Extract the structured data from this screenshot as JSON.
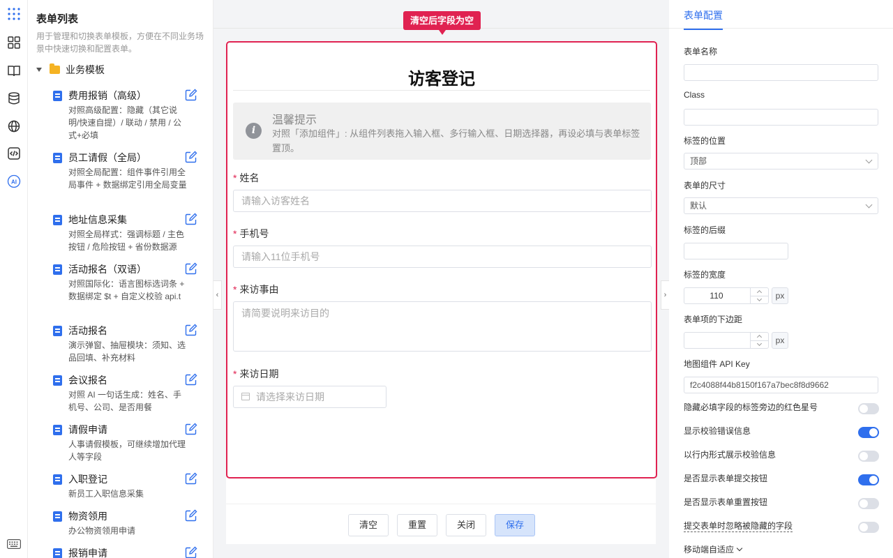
{
  "sidebar_list": {
    "title": "表单列表",
    "description": "用于管理和切换表单模板，方便在不同业务场景中快速切换和配置表单。",
    "group": "业务模板",
    "items": [
      {
        "name": "费用报销（高级）",
        "desc": "对照高级配置：隐藏（其它说明/快速自提）/ 联动 / 禁用 / 公式+必填"
      },
      {
        "name": "员工请假（全局）",
        "desc": "对照全局配置：组件事件引用全局事件 + 数据绑定引用全局变量"
      },
      {
        "name": "地址信息采集",
        "desc": "对照全局样式：强调标题 / 主色按钮 / 危险按钮 + 省份数据源"
      },
      {
        "name": "活动报名（双语）",
        "desc": "对照国际化：语言图标选词条 + 数据绑定 $t + 自定义校验 api.t"
      },
      {
        "name": "活动报名",
        "desc": "演示弹窗、抽屉模块：须知、选品回填、补充材料"
      },
      {
        "name": "会议报名",
        "desc": "对照 AI 一句话生成：姓名、手机号、公司、是否用餐"
      },
      {
        "name": "请假申请",
        "desc": "人事请假模板，可继续增加代理人等字段"
      },
      {
        "name": "入职登记",
        "desc": "新员工入职信息采集"
      },
      {
        "name": "物资领用",
        "desc": "办公物资领用申请"
      },
      {
        "name": "报销申请",
        "desc": ""
      }
    ]
  },
  "canvas": {
    "tooltip": "清空后字段为空",
    "form_title": "访客登记",
    "notice": {
      "title": "温馨提示",
      "body": "对照「添加组件」: 从组件列表拖入输入框、多行输入框、日期选择器，再设必填与表单标签置顶。"
    },
    "fields": [
      {
        "label": "姓名",
        "placeholder": "请输入访客姓名"
      },
      {
        "label": "手机号",
        "placeholder": "请输入11位手机号"
      },
      {
        "label": "来访事由",
        "placeholder": "请简要说明来访目的"
      },
      {
        "label": "来访日期",
        "placeholder": "请选择来访日期"
      }
    ],
    "buttons": {
      "clear": "清空",
      "reset": "重置",
      "close": "关闭",
      "save": "保存"
    }
  },
  "panel": {
    "tab": "表单配置",
    "form_name_label": "表单名称",
    "form_name_value": "",
    "class_label": "Class",
    "class_value": "",
    "label_position_label": "标签的位置",
    "label_position_value": "顶部",
    "size_label": "表单的尺寸",
    "size_value": "默认",
    "suffix_label": "标签的后缀",
    "suffix_value": "",
    "label_width_label": "标签的宽度",
    "label_width_value": "110",
    "unit": "px",
    "margin_label": "表单项的下边距",
    "margin_value": "",
    "api_key_label": "地图组件 API Key",
    "api_key_value": "f2c4088f44b8150f167a7bec8f8d9662",
    "switches": [
      {
        "label": "隐藏必填字段的标签旁边的红色星号",
        "on": false
      },
      {
        "label": "显示校验错误信息",
        "on": true
      },
      {
        "label": "以行内形式展示校验信息",
        "on": false
      },
      {
        "label": "是否显示表单提交按钮",
        "on": true
      },
      {
        "label": "是否显示表单重置按钮",
        "on": false
      },
      {
        "label": "提交表单时忽略被隐藏的字段",
        "on": false
      }
    ],
    "mobile_label": "移动端自适应"
  },
  "colors": {
    "accent": "#2f6fed",
    "highlight": "#e02251"
  }
}
